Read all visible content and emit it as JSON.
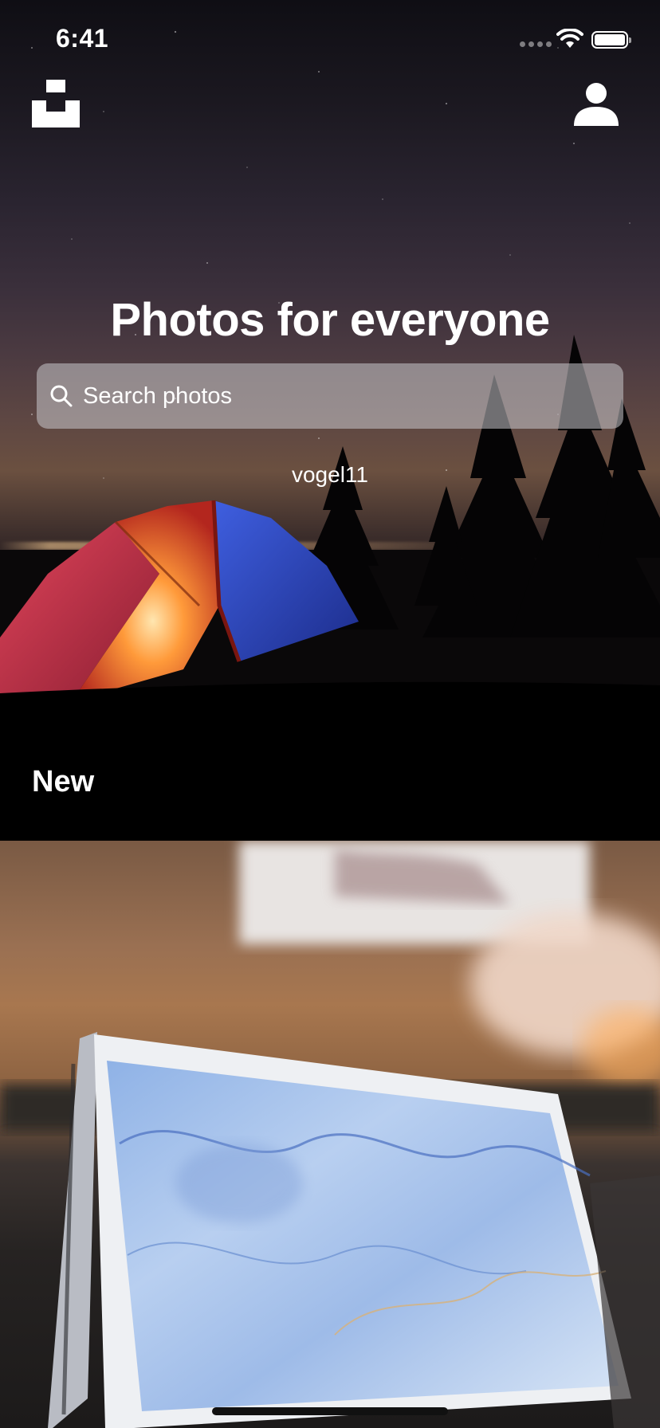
{
  "status_bar": {
    "time": "6:41"
  },
  "hero": {
    "title": "Photos for everyone",
    "search_placeholder": "Search photos",
    "photo_credit": "vogel11"
  },
  "sections": {
    "new_title": "New"
  },
  "icons": {
    "logo": "unsplash-logo-icon",
    "profile": "user-profile-icon",
    "search": "search-icon",
    "signal": "cellular-signal-icon",
    "wifi": "wifi-icon",
    "battery": "battery-icon"
  }
}
